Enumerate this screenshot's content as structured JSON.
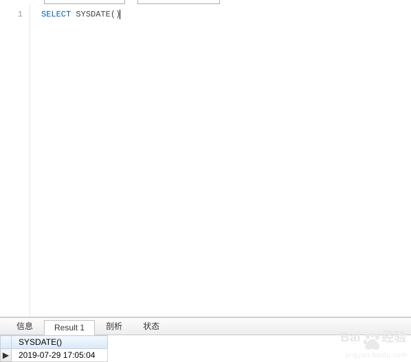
{
  "editor": {
    "line_no": "1",
    "keyword": "SELECT",
    "func": "SYSDATE",
    "parens": "()"
  },
  "tabs": {
    "info": "信息",
    "result": "Result 1",
    "profile": "剖析",
    "status": "状态"
  },
  "result": {
    "header": "SYSDATE()",
    "value": "2019-07-29 17:05:04",
    "row_marker": "▶"
  },
  "watermark": {
    "brand_prefix": "Bai",
    "brand_suffix": "经验",
    "url": "jingyan.baidu.com"
  }
}
